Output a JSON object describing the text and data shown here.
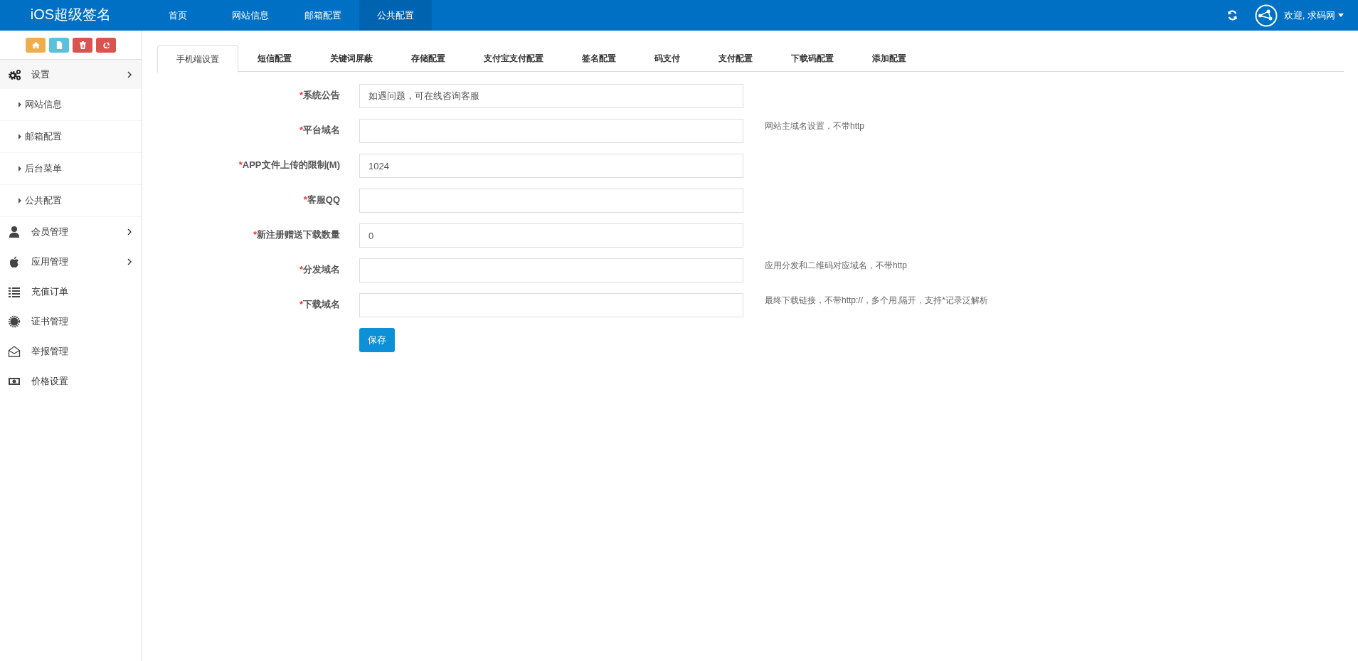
{
  "header": {
    "logo": "iOS超级签名",
    "nav": [
      {
        "label": "首页",
        "selected": false
      },
      {
        "label": "网站信息",
        "selected": false
      },
      {
        "label": "邮箱配置",
        "selected": false
      },
      {
        "label": "公共配置",
        "selected": true
      }
    ],
    "user": "欢迎, 求码网"
  },
  "sidebar": {
    "shortcuts": [
      {
        "kind": "home",
        "color": "#f0ad4e"
      },
      {
        "kind": "file",
        "color": "#5bc0de"
      },
      {
        "kind": "trash",
        "color": "#d9534f"
      },
      {
        "kind": "recycle",
        "color": "#d9534f"
      }
    ],
    "items": [
      {
        "label": "设置",
        "kind": "gears",
        "expanded": true,
        "children": [
          {
            "label": "网站信息"
          },
          {
            "label": "邮箱配置"
          },
          {
            "label": "后台菜单"
          },
          {
            "label": "公共配置"
          }
        ]
      },
      {
        "label": "会员管理",
        "kind": "user",
        "expanded": false
      },
      {
        "label": "应用管理",
        "kind": "apple",
        "expanded": false
      },
      {
        "label": "充值订单",
        "kind": "list"
      },
      {
        "label": "证书管理",
        "kind": "certificate"
      },
      {
        "label": "举报管理",
        "kind": "envelope"
      },
      {
        "label": "价格设置",
        "kind": "money"
      }
    ]
  },
  "tabs": [
    {
      "label": "手机端设置",
      "selected": true
    },
    {
      "label": "短信配置",
      "selected": false
    },
    {
      "label": "关键词屏蔽",
      "selected": false
    },
    {
      "label": "存储配置",
      "selected": false
    },
    {
      "label": "支付宝支付配置",
      "selected": false
    },
    {
      "label": "签名配置",
      "selected": false
    },
    {
      "label": "码支付",
      "selected": false
    },
    {
      "label": "支付配置",
      "selected": false
    },
    {
      "label": "下载码配置",
      "selected": false
    },
    {
      "label": "添加配置",
      "selected": false
    }
  ],
  "form": {
    "fields": [
      {
        "mark": "*",
        "label": "系统公告",
        "value": "如遇问题，可在线咨询客服"
      },
      {
        "mark": "*",
        "label": "平台域名",
        "help": "网站主域名设置，不带http"
      },
      {
        "mark": "*",
        "label": "APP文件上传的限制(M)",
        "value": "1024"
      },
      {
        "mark": "*",
        "label": "客服QQ"
      },
      {
        "mark": "*",
        "label": "新注册赠送下载数量",
        "value": "0"
      },
      {
        "mark": "*",
        "label": "分发域名",
        "help": "应用分发和二维码对应域名，不带http"
      },
      {
        "mark": "*",
        "label": "下载域名",
        "help": "最终下载链接，不带http://，多个用,隔开，支持*记录泛解析"
      }
    ],
    "submit": "保存"
  }
}
